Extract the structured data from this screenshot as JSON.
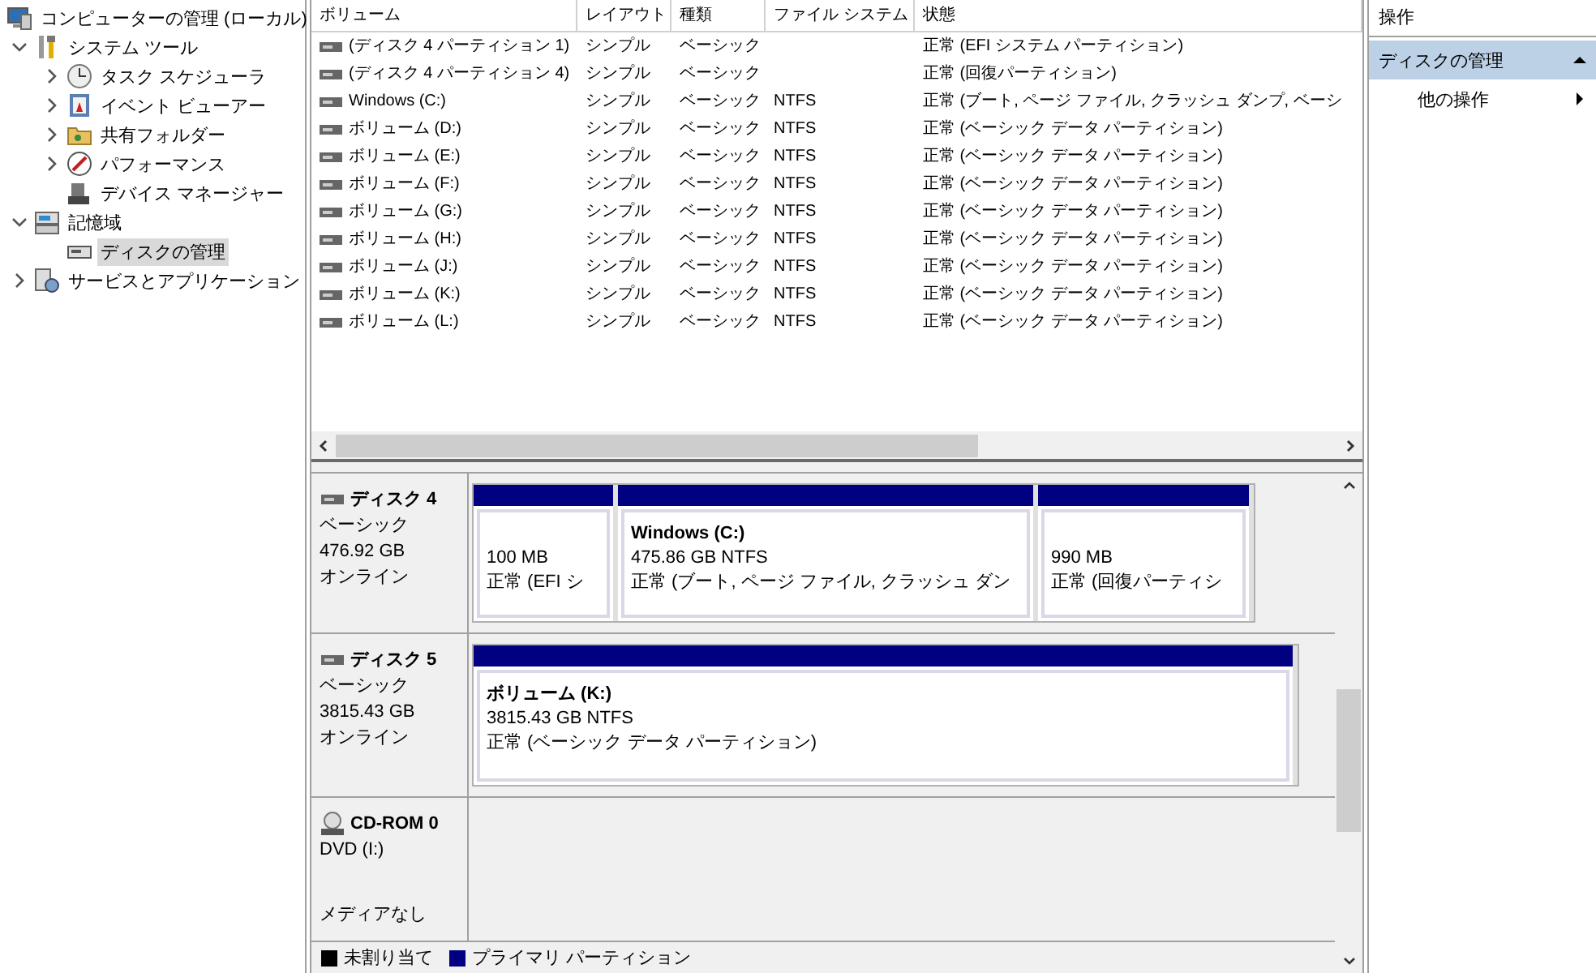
{
  "tree": [
    {
      "label": "コンピューターの管理 (ローカル)",
      "kind": "computer",
      "selected": false,
      "children": [
        {
          "label": "システム ツール",
          "kind": "tools",
          "expanded": true,
          "selected": false,
          "children": [
            {
              "label": "タスク スケジューラ",
              "kind": "clock",
              "expanded": false,
              "selected": false
            },
            {
              "label": "イベント ビューアー",
              "kind": "event",
              "expanded": false,
              "selected": false
            },
            {
              "label": "共有フォルダー",
              "kind": "folder",
              "expanded": false,
              "selected": false
            },
            {
              "label": "パフォーマンス",
              "kind": "perf",
              "expanded": false,
              "selected": false
            },
            {
              "label": "デバイス マネージャー",
              "kind": "device",
              "selected": false
            }
          ]
        },
        {
          "label": "記憶域",
          "kind": "storage",
          "expanded": true,
          "selected": false,
          "children": [
            {
              "label": "ディスクの管理",
              "kind": "disk",
              "selected": true
            }
          ]
        },
        {
          "label": "サービスとアプリケーション",
          "kind": "services",
          "expanded": false,
          "selected": false
        }
      ]
    }
  ],
  "volumes": {
    "columns": [
      "ボリューム",
      "レイアウト",
      "種類",
      "ファイル システム",
      "状態"
    ],
    "rows": [
      [
        "(ディスク 4 パーティション 1)",
        "シンプル",
        "ベーシック",
        "",
        "正常 (EFI システム パーティション)"
      ],
      [
        "(ディスク 4 パーティション 4)",
        "シンプル",
        "ベーシック",
        "",
        "正常 (回復パーティション)"
      ],
      [
        "Windows (C:)",
        "シンプル",
        "ベーシック",
        "NTFS",
        "正常 (ブート, ページ ファイル, クラッシュ ダンプ, ベーシ"
      ],
      [
        "ボリューム (D:)",
        "シンプル",
        "ベーシック",
        "NTFS",
        "正常 (ベーシック データ パーティション)"
      ],
      [
        "ボリューム (E:)",
        "シンプル",
        "ベーシック",
        "NTFS",
        "正常 (ベーシック データ パーティション)"
      ],
      [
        "ボリューム (F:)",
        "シンプル",
        "ベーシック",
        "NTFS",
        "正常 (ベーシック データ パーティション)"
      ],
      [
        "ボリューム (G:)",
        "シンプル",
        "ベーシック",
        "NTFS",
        "正常 (ベーシック データ パーティション)"
      ],
      [
        "ボリューム (H:)",
        "シンプル",
        "ベーシック",
        "NTFS",
        "正常 (ベーシック データ パーティション)"
      ],
      [
        "ボリューム (J:)",
        "シンプル",
        "ベーシック",
        "NTFS",
        "正常 (ベーシック データ パーティション)"
      ],
      [
        "ボリューム (K:)",
        "シンプル",
        "ベーシック",
        "NTFS",
        "正常 (ベーシック データ パーティション)"
      ],
      [
        "ボリューム (L:)",
        "シンプル",
        "ベーシック",
        "NTFS",
        "正常 (ベーシック データ パーティション)"
      ]
    ]
  },
  "disks": [
    {
      "kind": "disk",
      "name": "ディスク 4",
      "type": "ベーシック",
      "size": "476.92 GB",
      "status": "オンライン",
      "partitions": [
        {
          "size": "100 MB",
          "status": "正常 (EFI シ"
        },
        {
          "label": "Windows  (C:)",
          "size": "475.86 GB NTFS",
          "status": "正常 (ブート, ページ ファイル, クラッシュ ダン"
        },
        {
          "size": "990 MB",
          "status": "正常 (回復パーティシ"
        }
      ]
    },
    {
      "kind": "disk",
      "name": "ディスク 5",
      "type": "ベーシック",
      "size": "3815.43 GB",
      "status": "オンライン",
      "partitions": [
        {
          "label": "ボリューム  (K:)",
          "size": "3815.43 GB NTFS",
          "status": "正常 (ベーシック データ パーティション)"
        }
      ]
    },
    {
      "kind": "cdrom",
      "name": "CD-ROM 0",
      "type": "DVD (I:)",
      "status": "メディアなし"
    }
  ],
  "legend": [
    {
      "label": "未割り当て",
      "color": "#000000"
    },
    {
      "label": "プライマリ パーティション",
      "color": "#000080"
    }
  ],
  "actions": {
    "title": "操作",
    "section": {
      "label": "ディスクの管理",
      "expanded": true
    },
    "items": [
      "他の操作"
    ]
  }
}
